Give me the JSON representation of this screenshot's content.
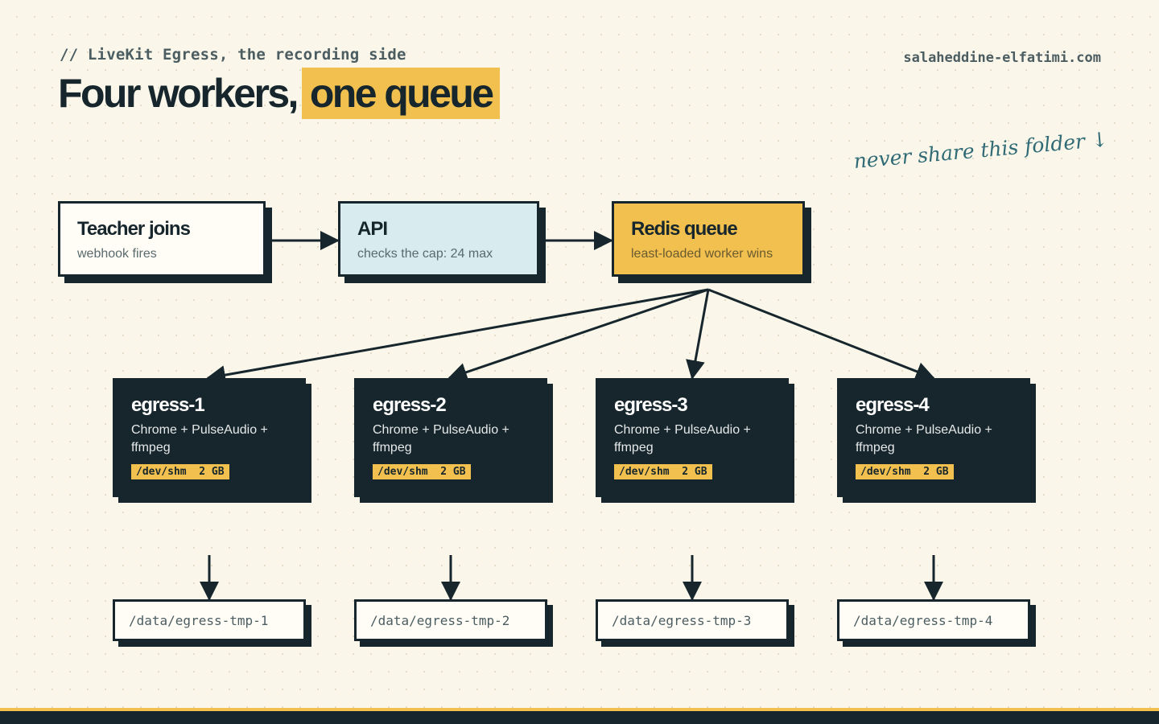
{
  "header": {
    "eyebrow": "// LiveKit Egress, the recording side",
    "title_main": "Four workers,",
    "title_highlight": "one queue",
    "site": "salaheddine-elfatimi.com"
  },
  "note": "never share this folder ↓",
  "pipeline": [
    {
      "title": "Teacher joins",
      "subtitle": "webhook fires"
    },
    {
      "title": "API",
      "subtitle": "checks the cap: 24 max"
    },
    {
      "title": "Redis queue",
      "subtitle": "least-loaded worker wins"
    }
  ],
  "workers": [
    {
      "name": "egress-1",
      "stack": "Chrome + PulseAudio + ffmpeg",
      "shm": "/dev/shm  2 GB",
      "folder": "/data/egress-tmp-1"
    },
    {
      "name": "egress-2",
      "stack": "Chrome + PulseAudio + ffmpeg",
      "shm": "/dev/shm  2 GB",
      "folder": "/data/egress-tmp-2"
    },
    {
      "name": "egress-3",
      "stack": "Chrome + PulseAudio + ffmpeg",
      "shm": "/dev/shm  2 GB",
      "folder": "/data/egress-tmp-3"
    },
    {
      "name": "egress-4",
      "stack": "Chrome + PulseAudio + ffmpeg",
      "shm": "/dev/shm  2 GB",
      "folder": "/data/egress-tmp-4"
    }
  ],
  "colors": {
    "ink": "#16262c",
    "accent": "#f2c04e",
    "api_bg": "#d8ebee",
    "paper": "#faf7ea",
    "note": "#2f6a75"
  }
}
